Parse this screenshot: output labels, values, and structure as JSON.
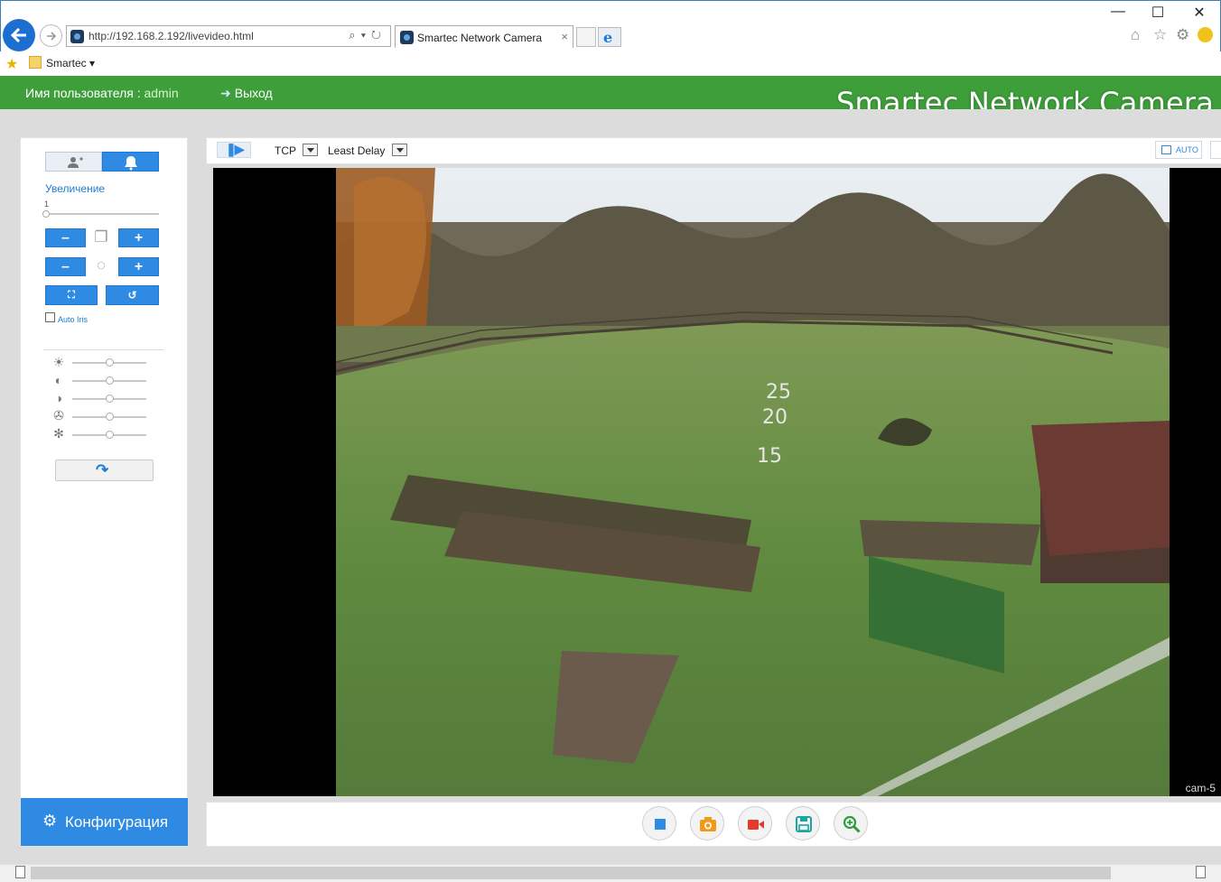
{
  "browser": {
    "address": "http://192.168.2.192/livevideo.html",
    "tab_title": "Smartec Network Camera",
    "tab_close": "×",
    "favorites_label": "Smartec ▾",
    "window_controls": {
      "minimize": "—",
      "maximize": "☐",
      "close": "✕"
    },
    "icons": [
      "home-icon",
      "star-icon",
      "gear-icon",
      "smiley-icon"
    ]
  },
  "header": {
    "user_prefix": "Имя пользователя : ",
    "user_name": "admin",
    "logout_label": "Выход",
    "camera_title": "Smartec Network Camera",
    "colors": {
      "bar": "#3e9e3a",
      "accent": "#2f8ae4"
    }
  },
  "left_panel": {
    "zoom_label": "Увеличение",
    "zoom_value": "1",
    "zoom_level": 0.0,
    "buttons": {
      "zoom_minus": "–",
      "zoom_plus": "+",
      "focus_minus": "–",
      "focus_plus": "+"
    },
    "auto_iris_label": "Auto Iris",
    "auto_iris_checked": false,
    "adjustments": [
      {
        "name": "brightness",
        "icon": "sun-icon",
        "level": 0.5
      },
      {
        "name": "contrast",
        "icon": "contrast-icon",
        "level": 0.5
      },
      {
        "name": "saturation",
        "icon": "saturation-icon",
        "level": 0.5
      },
      {
        "name": "hue",
        "icon": "hue-icon",
        "level": 0.5
      },
      {
        "name": "sharpness",
        "icon": "sharpness-icon",
        "level": 0.5
      }
    ],
    "config_label": "Конфигурация"
  },
  "video": {
    "protocol": "TCP",
    "stream_mode": "Least Delay",
    "auto_label": "AUTO",
    "overlay_label": "cam-5",
    "controls": [
      "stop-icon",
      "snapshot-icon",
      "record-icon",
      "save-icon",
      "zoom-icon"
    ]
  }
}
